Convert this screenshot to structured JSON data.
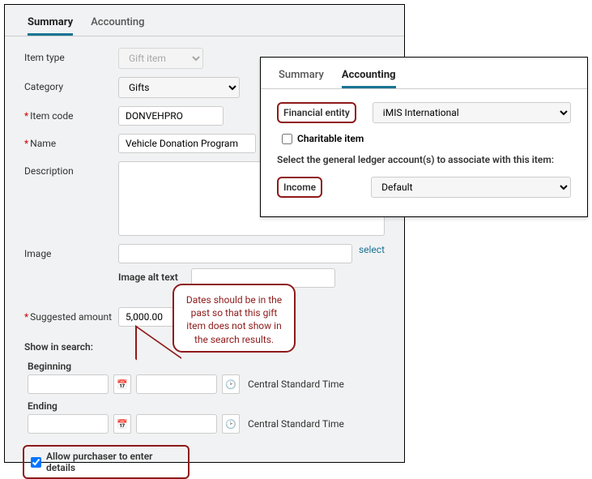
{
  "main": {
    "tabs": {
      "summary": "Summary",
      "accounting": "Accounting"
    },
    "labels": {
      "item_type": "Item type",
      "category": "Category",
      "item_code": "Item code",
      "name": "Name",
      "description": "Description",
      "image": "Image",
      "image_alt": "Image alt text",
      "suggested": "Suggested amount",
      "show_in_search": "Show in search:",
      "beginning": "Beginning",
      "ending": "Ending",
      "allow_purchaser": "Allow purchaser to enter details",
      "select_link": "select",
      "tz": "Central Standard Time"
    },
    "values": {
      "item_type": "Gift item",
      "category": "Gifts",
      "item_code": "DONVEHPRO",
      "name": "Vehicle Donation Program",
      "description": "",
      "image": "",
      "image_alt": "",
      "suggested": "5,000.00",
      "beginning_date": "",
      "beginning_time": "",
      "ending_date": "",
      "ending_time": "",
      "allow_purchaser": true
    }
  },
  "overlay": {
    "tabs": {
      "summary": "Summary",
      "accounting": "Accounting"
    },
    "labels": {
      "financial_entity": "Financial entity",
      "charitable": "Charitable item",
      "gl_help": "Select the general ledger account(s) to associate with this item:",
      "income": "Income"
    },
    "values": {
      "financial_entity": "iMIS International",
      "charitable": false,
      "income": "Default"
    }
  },
  "callout": "Dates should be in the past so that this gift item does not show in the search results."
}
